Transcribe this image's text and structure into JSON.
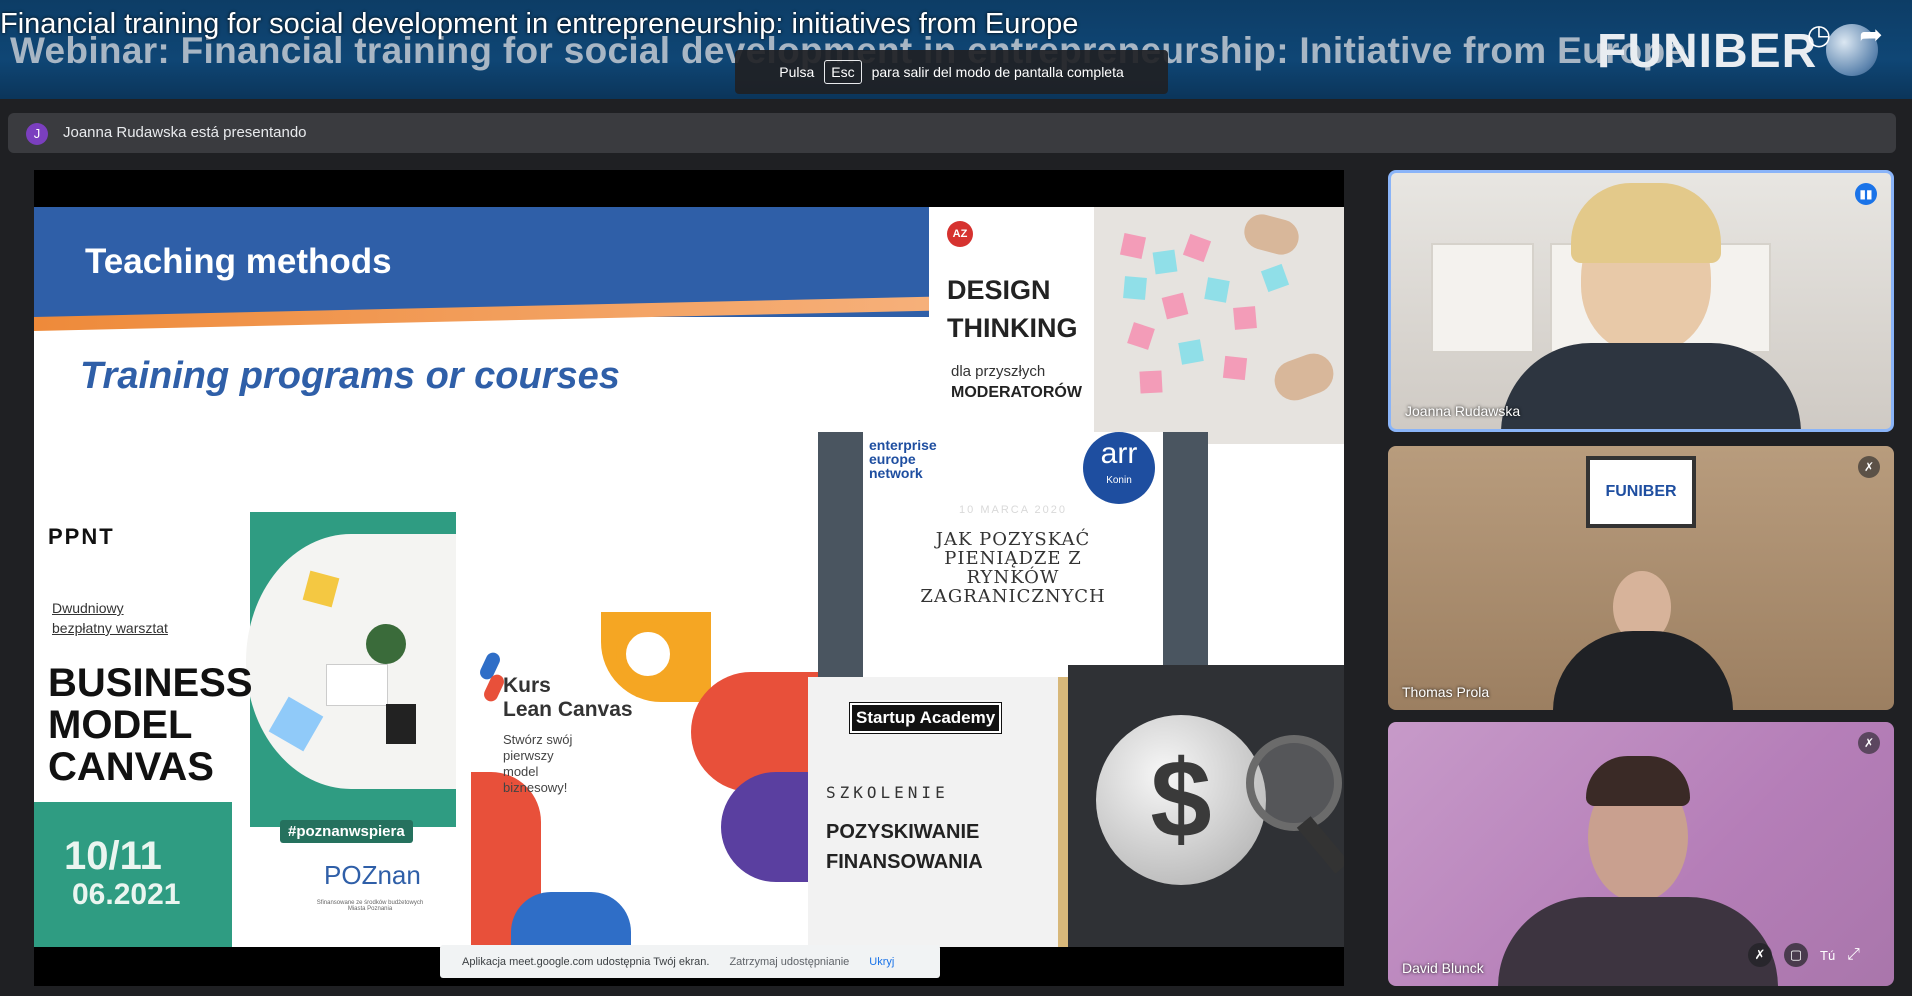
{
  "video": {
    "title": "Financial training for social development in entrepreneurship: initiatives from Europe",
    "banner": "Webinar: Financial training for social development in entrepreneurship: Initiative from Europe",
    "logo": "FUNIBER"
  },
  "fullscreen_hint": {
    "before": "Pulsa",
    "key": "Esc",
    "after": "para salir del modo de pantalla completa"
  },
  "presenting": {
    "avatar": "J",
    "text": "Joanna Rudawska está presentando"
  },
  "slide": {
    "title": "Teaching methods",
    "subtitle": "Training programs or courses",
    "design_thinking": {
      "badge": "AZ",
      "line1": "DESIGN",
      "line2": "THINKING",
      "small": "dla przyszłych",
      "bold": "MODERATORÓW"
    },
    "bmc": {
      "brand": "PPNT",
      "note1": "Dwudniowy",
      "note2": "bezpłatny warsztat",
      "l1": "BUSINESS",
      "l2": "MODEL",
      "l3": "CANVAS",
      "date1": "10/11",
      "date2": "06.2021",
      "hashtag": "#poznanwspiera",
      "city": "POZnan",
      "fine": "Sfinansowane ze środków budżetowych Miasta Poznania"
    },
    "lean": {
      "l1": "Kurs",
      "l2": "Lean Canvas",
      "d1": "Stwórz swój",
      "d2": "pierwszy",
      "d3": "model",
      "d4": "biznesowy!"
    },
    "een": {
      "l1": "enterprise",
      "l2": "europe",
      "l3": "network",
      "arr": "arr",
      "konin": "Konin",
      "date": "10 MARCA 2020",
      "t1": "JAK POZYSKAĆ",
      "t2": "PIENIĄDZE Z",
      "t3": "RYNKÓW",
      "t4": "ZAGRANICZNYCH"
    },
    "startup": {
      "label": "Startup Academy",
      "s1": "SZKOLENIE",
      "s2": "POZYSKIWANIE",
      "s3": "FINANSOWANIA"
    },
    "dollar": {
      "symbol": "$"
    }
  },
  "share_bar": {
    "info": "Aplikacja meet.google.com udostępnia Twój ekran.",
    "stop": "Zatrzymaj udostępnianie",
    "hide": "Ukryj"
  },
  "participants": [
    {
      "name": "Joanna Rudawska"
    },
    {
      "name": "Thomas Prola",
      "frame_logo": "FUNIBER"
    },
    {
      "name": "David Blunck"
    }
  ],
  "self_controls": {
    "you": "Tú"
  }
}
